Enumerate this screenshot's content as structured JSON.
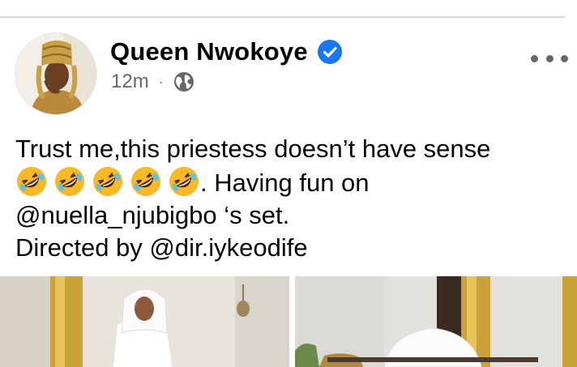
{
  "post": {
    "author": "Queen Nwokoye",
    "verified_icon": "verified-check-icon",
    "time": "12m",
    "separator": "·",
    "audience_icon": "globe-icon",
    "more_icon": "more-options-icon",
    "text_line1": "Trust me,this priestess doesn’t have sense",
    "emoji": [
      "rolling-on-floor-laughing",
      "rolling-on-floor-laughing",
      "rolling-on-floor-laughing",
      "rolling-on-floor-laughing",
      "rolling-on-floor-laughing"
    ],
    "text_line2_tail": ". Having fun on",
    "text_line3": "@nuella_njubigbo ‘s set.",
    "text_line4": "Directed by @dir.iykeodife",
    "photos": [
      "woman-in-white-veil-standing",
      "woman-in-white-veil-closeup"
    ]
  },
  "colors": {
    "verified": "#1877f2",
    "meta": "#65676b",
    "divider": "#d7d9dd"
  }
}
